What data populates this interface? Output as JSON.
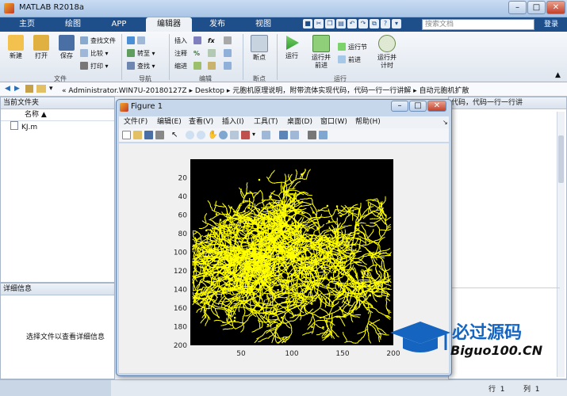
{
  "window": {
    "title": "MATLAB R2018a"
  },
  "tabs": [
    {
      "label": "主页",
      "active": false
    },
    {
      "label": "绘图",
      "active": false
    },
    {
      "label": "APP",
      "active": false
    },
    {
      "label": "编辑器",
      "active": true
    },
    {
      "label": "发布",
      "active": false
    },
    {
      "label": "视图",
      "active": false
    }
  ],
  "search": {
    "placeholder": "搜索文档"
  },
  "header": {
    "login": "登录"
  },
  "ribbon": {
    "file_group": "文件",
    "nav_group": "导航",
    "edit_group": "编辑",
    "breakpoint_group": "断点",
    "run_group": "运行",
    "new": "新建",
    "open": "打开",
    "save": "保存",
    "find_files": "查找文件",
    "compare": "比较",
    "print": "打印",
    "goto": "转至",
    "find": "查找",
    "insert": "插入",
    "comment": "注释",
    "indent": "缩进",
    "fx": "fx",
    "breakpoints": "断点",
    "run": "运行",
    "run_advance_1": "运行并",
    "run_advance_2": "前进",
    "run_section": "运行节",
    "advance": "前进",
    "run_time_1": "运行并",
    "run_time_2": "计时"
  },
  "address": {
    "path_prefix": "«",
    "segments": [
      "Administrator.WIN7U-20180127Z",
      "Desktop",
      "元胞机原理说明，附带流体实现代码，代码一行一行讲解",
      "自动元胞机扩散"
    ]
  },
  "current_folder": {
    "title": "当前文件夹",
    "column": "名称",
    "sort": "▲",
    "files": [
      "KJ.m"
    ]
  },
  "details": {
    "title": "详细信息",
    "message": "选择文件以查看详细信息"
  },
  "editor_tab_text": "代码，代码一行一行讲",
  "status": {
    "row_label": "行",
    "row": "1",
    "col_label": "列",
    "col": "1"
  },
  "figure": {
    "title": "Figure 1",
    "menu": [
      "文件(F)",
      "编辑(E)",
      "查看(V)",
      "插入(I)",
      "工具(T)",
      "桌面(D)",
      "窗口(W)",
      "帮助(H)"
    ]
  },
  "colors": {
    "accent": "#1f4f8b",
    "plot_bg": "#000000",
    "plot_fg": "#ffff00"
  },
  "chart_data": {
    "type": "heatmap",
    "description": "binary image of diffusion-limited aggregation",
    "xlim": [
      0,
      200
    ],
    "ylim": [
      0,
      200
    ],
    "xticks": [
      50,
      100,
      150,
      200
    ],
    "yticks": [
      20,
      40,
      60,
      80,
      100,
      120,
      140,
      160,
      180,
      200
    ],
    "background": "#000000",
    "foreground": "#ffff00"
  },
  "watermark": {
    "brand": "必过源码",
    "url": "Biguo100.CN"
  }
}
